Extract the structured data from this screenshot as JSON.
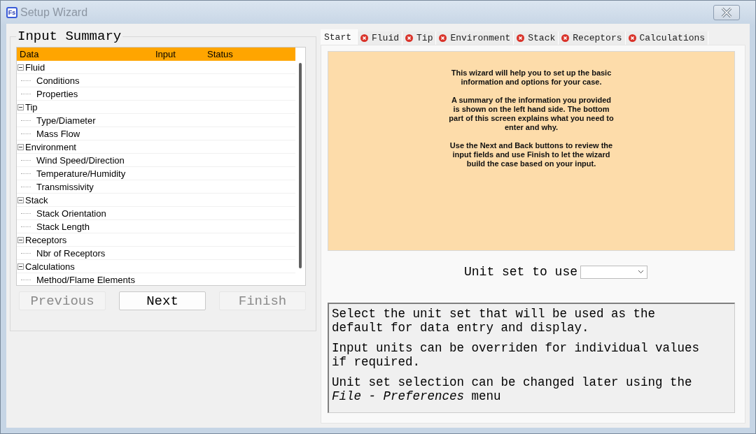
{
  "window": {
    "title": "Setup Wizard",
    "app_badge": "Fs"
  },
  "input_summary": {
    "title": "Input Summary",
    "columns": [
      "Data",
      "Input",
      "Status"
    ],
    "tree": [
      {
        "label": "Fluid",
        "expanded": true,
        "children": [
          {
            "label": "Conditions"
          },
          {
            "label": "Properties"
          }
        ]
      },
      {
        "label": "Tip",
        "expanded": true,
        "children": [
          {
            "label": "Type/Diameter"
          },
          {
            "label": "Mass Flow"
          }
        ]
      },
      {
        "label": "Environment",
        "expanded": true,
        "children": [
          {
            "label": "Wind Speed/Direction"
          },
          {
            "label": "Temperature/Humidity"
          },
          {
            "label": "Transmissivity"
          }
        ]
      },
      {
        "label": "Stack",
        "expanded": true,
        "children": [
          {
            "label": "Stack Orientation"
          },
          {
            "label": "Stack Length"
          }
        ]
      },
      {
        "label": "Receptors",
        "expanded": true,
        "children": [
          {
            "label": "Nbr of Receptors"
          }
        ]
      },
      {
        "label": "Calculations",
        "expanded": true,
        "children": [
          {
            "label": "Method/Flame Elements"
          }
        ]
      }
    ]
  },
  "nav_buttons": [
    {
      "label": "Previous",
      "disabled": true
    },
    {
      "label": "Next",
      "disabled": false
    },
    {
      "label": "Finish",
      "disabled": true
    }
  ],
  "tabs": [
    {
      "label": "Start",
      "selected": true,
      "error": false
    },
    {
      "label": "Fluid",
      "selected": false,
      "error": true
    },
    {
      "label": "Tip",
      "selected": false,
      "error": true
    },
    {
      "label": "Environment",
      "selected": false,
      "error": true
    },
    {
      "label": "Stack",
      "selected": false,
      "error": true
    },
    {
      "label": "Receptors",
      "selected": false,
      "error": true
    },
    {
      "label": "Calculations",
      "selected": false,
      "error": true
    }
  ],
  "intro": [
    "This wizard will help you to set up the basic information and options for your case.",
    "A summary of the information you provided is shown on the left hand side.  The bottom part of this screen explains what you need to enter and why.",
    "Use the Next and Back buttons to review the input fields and use Finish to let the wizard build the case based on your input."
  ],
  "unit_set": {
    "label": "Unit set to use"
  },
  "help": [
    "Select the unit set that will be used as the default for data entry and display.",
    "Input units can be overriden for individual values if required.",
    "Unit set selection can be changed later using the *File - Preferences* menu"
  ]
}
